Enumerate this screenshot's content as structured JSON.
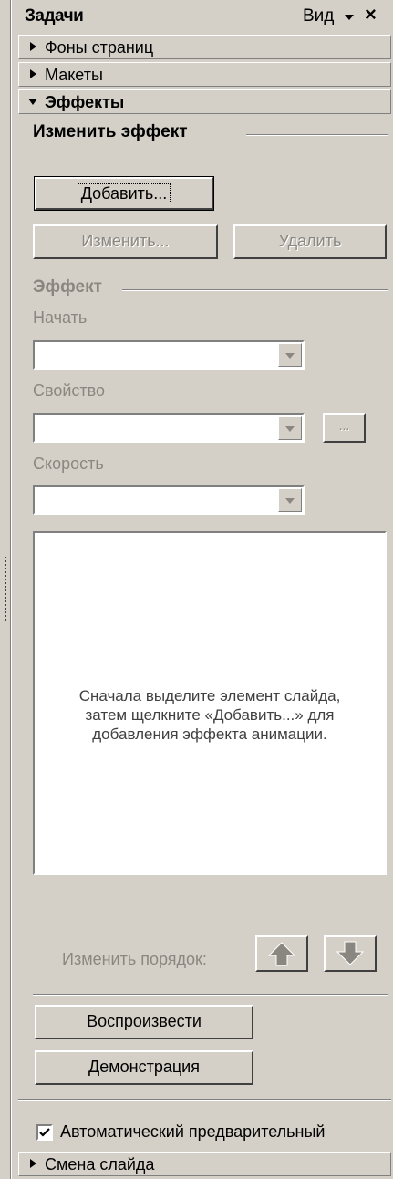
{
  "pane": {
    "title": "Задачи",
    "view_label": "Вид",
    "close_glyph": "×"
  },
  "sections": {
    "backgrounds": "Фоны страниц",
    "layouts": "Макеты",
    "effects": "Эффекты",
    "slide_transition": "Смена слайда"
  },
  "modify": {
    "group_title": "Изменить эффект",
    "add_button": "Добавить...",
    "change_button": "Изменить...",
    "delete_button": "Удалить"
  },
  "effect": {
    "group_title": "Эффект",
    "start_label": "Начать",
    "start_value": "",
    "property_label": "Свойство",
    "property_value": "",
    "property_more": "...",
    "speed_label": "Скорость",
    "speed_value": ""
  },
  "list": {
    "hint": "Сначала выделите элемент слайда, затем щелкните «Добавить...» для добавления эффекта анимации."
  },
  "reorder": {
    "label": "Изменить порядок:"
  },
  "actions": {
    "play": "Воспроизвести",
    "slideshow": "Демонстрация"
  },
  "autopreview": {
    "label": "Автоматический предварительный",
    "checked": true
  }
}
